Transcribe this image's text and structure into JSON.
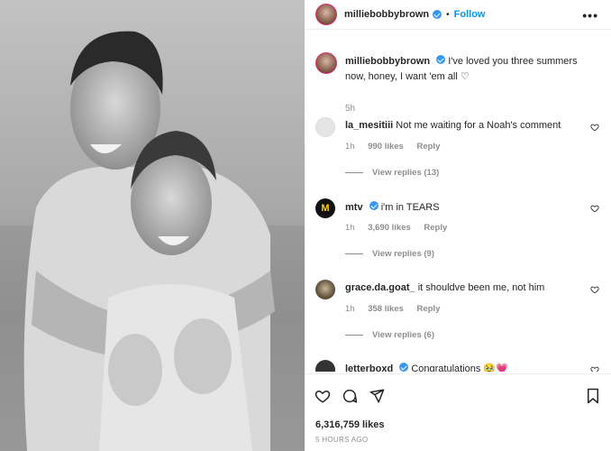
{
  "post": {
    "username": "milliebobbybrown",
    "follow_label": "Follow",
    "dot": "•",
    "more_label": "•••"
  },
  "caption": {
    "username": "milliebobbybrown",
    "text": "I've loved you three summers now, honey, I want 'em all ♡",
    "time": "5h"
  },
  "comments": [
    {
      "username": "la_mesitiii",
      "text": "Not me waiting for a Noah's comment",
      "time": "1h",
      "likes": "990 likes",
      "reply_label": "Reply",
      "replies_label": "View replies (13)"
    },
    {
      "username": "mtv",
      "text": "i'm in TEARS",
      "time": "1h",
      "likes": "3,690 likes",
      "reply_label": "Reply",
      "replies_label": "View replies (9)",
      "avatar_text": "M"
    },
    {
      "username": "grace.da.goat_",
      "text": "it shouldve been me, not him",
      "time": "1h",
      "likes": "358 likes",
      "reply_label": "Reply",
      "replies_label": "View replies (6)"
    },
    {
      "username": "letterboxd",
      "text": "Congratulations 🥹💗"
    }
  ],
  "footer": {
    "likes": "6,316,759 likes",
    "time": "5 HOURS AGO"
  },
  "colors": {
    "accent": "#0095f6",
    "verified": "#3897f0",
    "muted": "#8e8e8e",
    "text": "#262626"
  },
  "icons": [
    "heart-icon",
    "comment-icon",
    "share-icon",
    "bookmark-icon",
    "verified-icon",
    "more-icon"
  ]
}
